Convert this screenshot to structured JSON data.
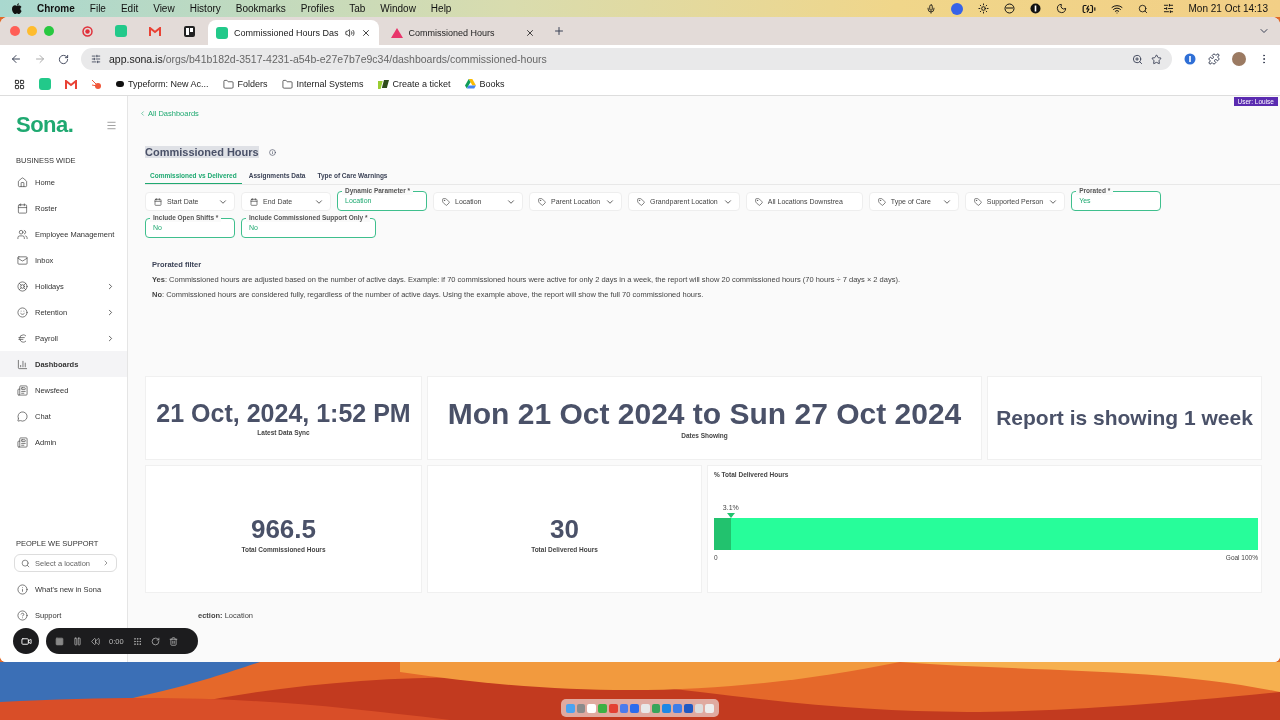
{
  "menu_bar": {
    "app": "Chrome",
    "menus": [
      "File",
      "Edit",
      "View",
      "History",
      "Bookmarks",
      "Profiles",
      "Tab",
      "Window",
      "Help"
    ],
    "clock": "Mon 21 Oct  14:13"
  },
  "browser_tabs": [
    {
      "title": "Commissioned Hours Das",
      "selected": true,
      "audio": true
    },
    {
      "title": "Commissioned Hours",
      "selected": false,
      "audio": false
    }
  ],
  "address": {
    "host": "app.sona.is",
    "path": "/orgs/b41b182d-3517-4231-a54b-e27e7b7e9c34/dashboards/commissioned-hours"
  },
  "bookmarks": [
    {
      "label": "Typeform: New Ac...",
      "kind": "typeform"
    },
    {
      "label": "Folders",
      "kind": "folder"
    },
    {
      "label": "Internal Systems",
      "kind": "folder"
    },
    {
      "label": "Create a ticket",
      "kind": "ticket"
    },
    {
      "label": "Books",
      "kind": "drive"
    }
  ],
  "user_badge": "User: Louise",
  "sidebar": {
    "logo": "Sona.",
    "section": "BUSINESS WIDE",
    "items": [
      {
        "label": "Home",
        "submenu": false,
        "selected": false
      },
      {
        "label": "Roster",
        "submenu": false,
        "selected": false
      },
      {
        "label": "Employee Management",
        "submenu": false,
        "selected": false
      },
      {
        "label": "Inbox",
        "submenu": false,
        "selected": false
      },
      {
        "label": "Holidays",
        "submenu": true,
        "selected": false
      },
      {
        "label": "Retention",
        "submenu": true,
        "selected": false
      },
      {
        "label": "Payroll",
        "submenu": true,
        "selected": false
      },
      {
        "label": "Dashboards",
        "submenu": false,
        "selected": true
      },
      {
        "label": "Newsfeed",
        "submenu": false,
        "selected": false
      },
      {
        "label": "Chat",
        "submenu": false,
        "selected": false
      },
      {
        "label": "Admin",
        "submenu": false,
        "selected": false
      }
    ],
    "people_section": "PEOPLE WE SUPPORT",
    "location_search": {
      "placeholder": "Select a location"
    },
    "footer_items": [
      {
        "label": "What's new in Sona"
      },
      {
        "label": "Support"
      }
    ]
  },
  "back_link": "All Dashboards",
  "title": "Commissioned Hours",
  "tabs": [
    {
      "label": "Commissioned vs Delivered",
      "selected": true
    },
    {
      "label": "Assignments Data",
      "selected": false
    },
    {
      "label": "Type of Care Warnings",
      "selected": false
    }
  ],
  "filters": [
    {
      "kind": "date",
      "label": "Start Date"
    },
    {
      "kind": "date",
      "label": "End Date"
    },
    {
      "kind": "param",
      "label": "Dynamic Parameter *",
      "value": "Location"
    },
    {
      "kind": "select",
      "label": "Location"
    },
    {
      "kind": "select",
      "label": "Parent Location"
    },
    {
      "kind": "select",
      "label": "Grandparent Location"
    },
    {
      "kind": "text",
      "label": "All Locations Downstrea"
    },
    {
      "kind": "select",
      "label": "Type of Care"
    },
    {
      "kind": "select",
      "label": "Supported Person"
    },
    {
      "kind": "param",
      "label": "Prorated *",
      "value": "Yes"
    },
    {
      "kind": "param",
      "label": "Include Open Shifts *",
      "value": "No"
    },
    {
      "kind": "param",
      "label": "Include Commissioned Support Only *",
      "value": "No"
    }
  ],
  "note": {
    "title": "Prorated filter",
    "lines": [
      "**Yes**: Commissioned hours are adjusted based on the number of active days. Example: if 70 commissioned hours were active for only 2 days in a week, the report will show 20 commissioned hours (70 hours ÷ 7 days × 2 days).",
      "**No**: Commissioned hours are considered fully, regardless of the number of active days. Using the example above, the report will show the full 70 commissioned hours."
    ]
  },
  "stats_top": [
    {
      "value": "21 Oct, 2024, 1:52 PM",
      "label": "Latest Data Sync"
    },
    {
      "value": "Mon 21 Oct 2024 to Sun 27 Oct 2024",
      "label": "Dates Showing"
    },
    {
      "value": "Report is showing 1 week"
    }
  ],
  "stats_bottom": [
    {
      "value": "966.5",
      "label": "Total Commissioned Hours"
    },
    {
      "value": "30",
      "label": "Total Delivered Hours"
    }
  ],
  "progress": {
    "title": "% Total Delivered Hours",
    "level": 0.031,
    "reading": "3.1%",
    "min": "0",
    "goal": "Goal 100%"
  },
  "footer_text": "**ection:** Location",
  "recorder": {
    "time": "0:00"
  }
}
